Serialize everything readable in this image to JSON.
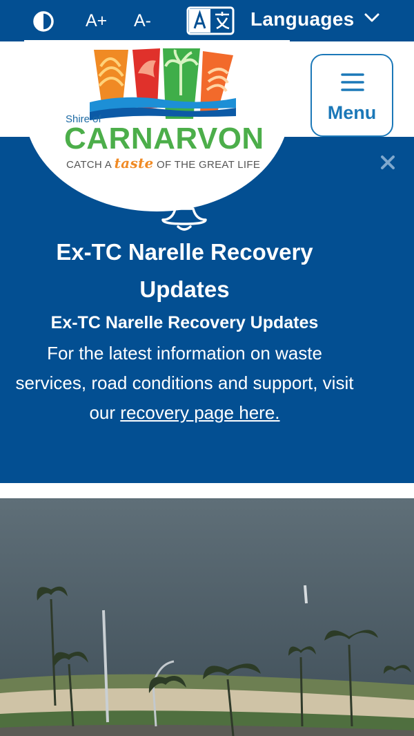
{
  "topbar": {
    "contrast_icon": "contrast-icon",
    "font_increase_label": "A+",
    "font_decrease_label": "A-",
    "translate_icon": "translate-icon",
    "languages_label": "Languages",
    "chevron_icon": "chevron-down-icon"
  },
  "logo": {
    "shire_of": "Shire of",
    "name": "CARNARVON",
    "tagline_before": "CATCH A ",
    "tagline_emphasis": "taste",
    "tagline_after": " OF THE GREAT LIFE"
  },
  "menu": {
    "label": "Menu",
    "icon": "hamburger-icon"
  },
  "alert": {
    "icon": "bell-icon",
    "close_icon": "close-icon",
    "title": "Ex-TC Narelle Recovery Updates",
    "subtitle": "Ex-TC Narelle Recovery Updates",
    "body_text": "For the latest information on waste services, road conditions and support, visit our ",
    "link_text": "recovery page here."
  },
  "colors": {
    "brand_blue": "#034f92",
    "accent_blue": "#1b78b8",
    "logo_green": "#4cae4a",
    "logo_orange": "#f08a24"
  }
}
